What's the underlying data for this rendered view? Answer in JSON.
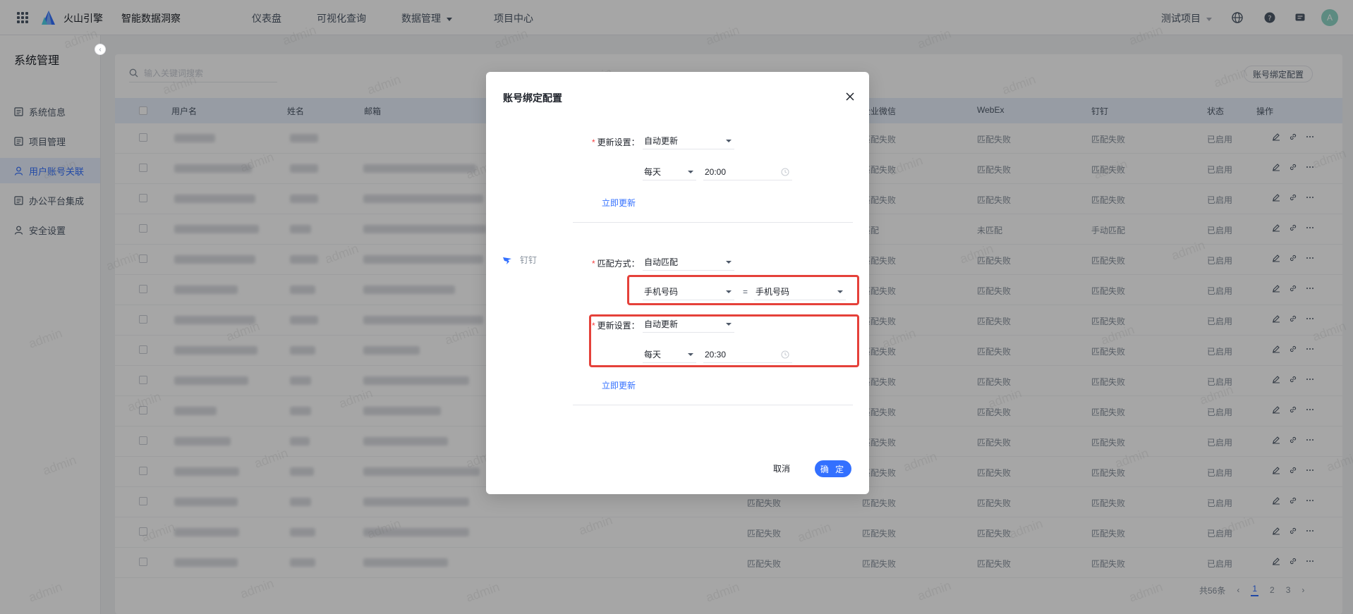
{
  "topbar": {
    "brand": "火山引擎",
    "product": "智能数据洞察",
    "nav": [
      "仪表盘",
      "可视化查询",
      "数据管理",
      "项目中心"
    ],
    "project": "测试项目",
    "avatar": "A",
    "icons": [
      "apps-grid-icon",
      "globe-icon",
      "help-icon",
      "message-icon"
    ]
  },
  "sidebar": {
    "title": "系统管理",
    "items": [
      {
        "label": "系统信息",
        "icon": "document-icon",
        "active": false
      },
      {
        "label": "项目管理",
        "icon": "document-icon",
        "active": false
      },
      {
        "label": "用户账号关联",
        "icon": "user-icon",
        "active": true
      },
      {
        "label": "办公平台集成",
        "icon": "document-icon",
        "active": false
      },
      {
        "label": "安全设置",
        "icon": "user-icon",
        "active": false
      }
    ]
  },
  "main": {
    "search_placeholder": "输入关键词搜索",
    "bind_config_button": "账号绑定配置",
    "columns": [
      "用户名",
      "姓名",
      "邮箱",
      "企业微信",
      "WebEx",
      "钉钉",
      "状态",
      "操作"
    ],
    "rows": [
      {
        "col5": "",
        "wechat": "匹配失败",
        "webex": "匹配失败",
        "dingtalk": "匹配失败",
        "status": "已启用"
      },
      {
        "col5": "",
        "wechat": "匹配失败",
        "webex": "匹配失败",
        "dingtalk": "匹配失败",
        "status": "已启用"
      },
      {
        "col5": "",
        "wechat": "匹配失败",
        "webex": "匹配失败",
        "dingtalk": "匹配失败",
        "status": "已启用"
      },
      {
        "col5": "",
        "wechat": "匹配",
        "webex": "未匹配",
        "dingtalk": "手动匹配",
        "status": "已启用"
      },
      {
        "col5": "",
        "wechat": "匹配失败",
        "webex": "匹配失败",
        "dingtalk": "匹配失败",
        "status": "已启用"
      },
      {
        "col5": "",
        "wechat": "匹配失败",
        "webex": "匹配失败",
        "dingtalk": "匹配失败",
        "status": "已启用"
      },
      {
        "col5": "",
        "wechat": "匹配失败",
        "webex": "匹配失败",
        "dingtalk": "匹配失败",
        "status": "已启用"
      },
      {
        "col5": "",
        "wechat": "匹配失败",
        "webex": "匹配失败",
        "dingtalk": "匹配失败",
        "status": "已启用"
      },
      {
        "col5": "",
        "wechat": "匹配失败",
        "webex": "匹配失败",
        "dingtalk": "匹配失败",
        "status": "已启用"
      },
      {
        "col5": "",
        "wechat": "匹配失败",
        "webex": "匹配失败",
        "dingtalk": "匹配失败",
        "status": "已启用"
      },
      {
        "col5": "",
        "wechat": "匹配失败",
        "webex": "匹配失败",
        "dingtalk": "匹配失败",
        "status": "已启用"
      },
      {
        "col5": "",
        "wechat": "匹配失败",
        "webex": "匹配失败",
        "dingtalk": "匹配失败",
        "status": "已启用"
      },
      {
        "col5": "匹配失败",
        "wechat": "匹配失败",
        "webex": "匹配失败",
        "dingtalk": "匹配失败",
        "status": "已启用"
      },
      {
        "col5": "匹配失败",
        "wechat": "匹配失败",
        "webex": "匹配失败",
        "dingtalk": "匹配失败",
        "status": "已启用"
      },
      {
        "col5": "匹配失败",
        "wechat": "匹配失败",
        "webex": "匹配失败",
        "dingtalk": "匹配失败",
        "status": "已启用"
      }
    ],
    "pagination": {
      "total": "共56条",
      "pages": [
        "1",
        "2",
        "3"
      ],
      "current": "1"
    }
  },
  "watermark": "admin",
  "modal": {
    "title": "账号绑定配置",
    "wechat_section": {
      "update_label": "更新设置：",
      "update_mode": "自动更新",
      "frequency": "每天",
      "time": "20:00",
      "update_now": "立即更新"
    },
    "dingtalk_section": {
      "platform": "钉钉",
      "match_label": "匹配方式：",
      "match_mode": "自动匹配",
      "match_left": "手机号码",
      "equals": "=",
      "match_right": "手机号码",
      "update_label": "更新设置：",
      "update_mode": "自动更新",
      "frequency": "每天",
      "time": "20:30",
      "update_now": "立即更新"
    },
    "cancel": "取消",
    "confirm": "确 定"
  },
  "colors": {
    "primary": "#3370ff",
    "highlight": "#e5413a",
    "required": "#f53f3f"
  }
}
